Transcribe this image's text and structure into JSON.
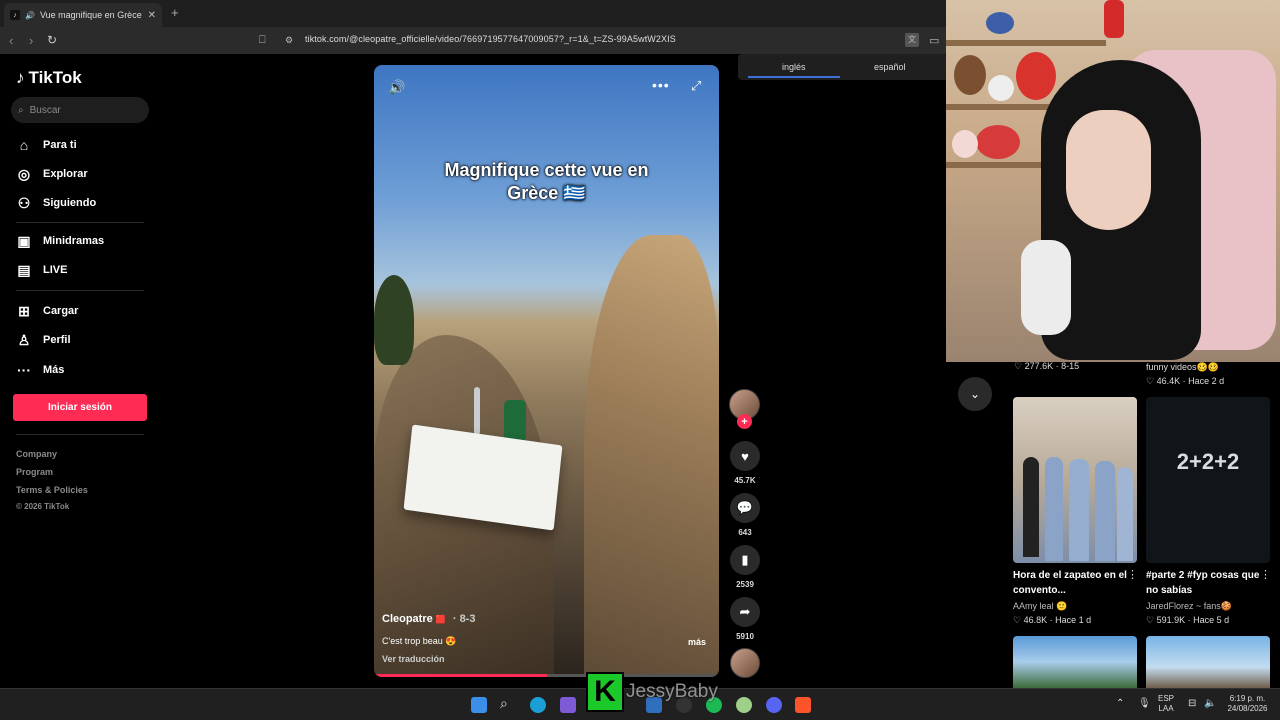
{
  "browser": {
    "tab_title": "Vue magnifique en Grèce : Cl",
    "tab_close": "✕",
    "new_tab": "+",
    "url": "tiktok.com/@cleopatre_officielle/video/7669719577647009057?_r=1&_t=ZS-99A5wtW2XIS"
  },
  "translate_popup": {
    "lang1": "inglés",
    "lang2": "español"
  },
  "sidebar": {
    "logo": "TikTok",
    "search_placeholder": "Buscar",
    "items": [
      {
        "label": "Para ti",
        "icon": "home-icon"
      },
      {
        "label": "Explorar",
        "icon": "compass-icon"
      },
      {
        "label": "Siguiendo",
        "icon": "following-icon"
      },
      {
        "label": "Minidramas",
        "icon": "minidramas-icon"
      },
      {
        "label": "LIVE",
        "icon": "live-icon"
      },
      {
        "label": "Cargar",
        "icon": "upload-icon"
      },
      {
        "label": "Perfil",
        "icon": "profile-icon"
      },
      {
        "label": "Más",
        "icon": "more-icon"
      }
    ],
    "login": "Iniciar sesión",
    "footer": [
      "Company",
      "Program",
      "Terms & Policies",
      "© 2026 TikTok"
    ]
  },
  "video": {
    "overlay_title_line1": "Magnifique cette vue en",
    "overlay_title_line2": "Grèce 🇬🇷",
    "author": "Cleopatre",
    "author_badge": "🟥",
    "date": "· 8-3",
    "caption": "C'est trop beau 😍",
    "translate": "Ver traducción",
    "more": "más",
    "progress": 0.5
  },
  "actions": {
    "likes": "45.7K",
    "comments": "643",
    "saves": "2539",
    "shares": "5910"
  },
  "related": {
    "top_left_stats": "♡ 277.6K · 8-15",
    "top_right_title": "funny videos🥴🥴",
    "top_right_stats": "♡ 46.4K · Hace 2 d",
    "items": [
      {
        "title": "Hora de el zapateo en el convento...",
        "author": "AAmy leal 🙂",
        "stats": "♡ 46.8K · Hace 1 d"
      },
      {
        "title": "#parte 2 #fyp cosas que no sabías",
        "author": "JaredFlorez ~ fans🍪",
        "stats": "♡ 591.9K · Hace 5 d"
      }
    ],
    "thumb2_text": "2+2+2"
  },
  "overlay": {
    "badge_letter": "K",
    "streamer": "JessyBaby"
  },
  "taskbar": {
    "lang": "ESP",
    "layout": "LAA",
    "time": "6:19 p. m.",
    "date": "24/08/2026"
  },
  "colors": {
    "accent": "#fe2c55",
    "badge_green": "#1bc92a"
  }
}
